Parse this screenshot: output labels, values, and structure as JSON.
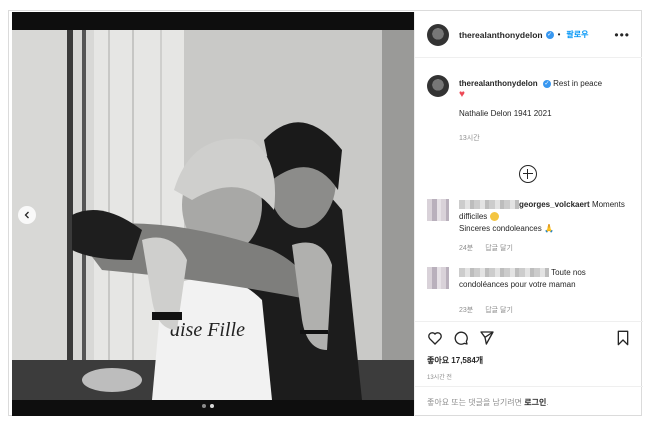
{
  "post": {
    "username": "therealanthonydelon",
    "verified_mark": "✓",
    "follow_label": "팔로우",
    "more_label": "•••"
  },
  "caption": {
    "username": "therealanthonydelon",
    "text": "Rest in peace",
    "heart": "♥",
    "line2": "Nathalie Delon 1941 2021",
    "time": "13시간"
  },
  "comments": [
    {
      "username": "georges_volckaert",
      "text": "Moments difficiles",
      "text2": "Sinceres condoleances 🙏",
      "time": "24분",
      "reply": "답글 달기"
    },
    {
      "username": "",
      "text": "Toute nos condoléances pour votre maman",
      "time": "23분",
      "reply": "답글 달기"
    }
  ],
  "actions": {
    "likes": "좋아요 17,584개",
    "ago": "13시간 전"
  },
  "login_prompt": {
    "text": "좋아요 또는 댓글을 남기려면",
    "link": "로그인",
    "suffix": "."
  },
  "photo": {
    "shirt_text": "aise Fille"
  },
  "colors": {
    "accent": "#0095f6",
    "heart": "#ed4956",
    "muted": "#8e8e8e"
  }
}
